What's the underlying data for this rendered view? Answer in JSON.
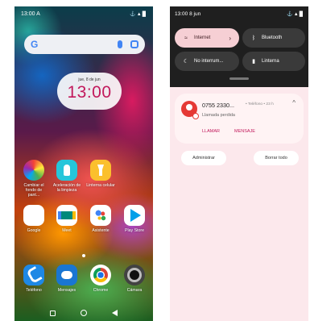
{
  "left_phone": {
    "status": {
      "time": "13:00",
      "extra": "A",
      "icons": "⚓▲█"
    },
    "search": {
      "logo": "G"
    },
    "clock": {
      "date": "jue, 8 de jun",
      "time": "13:00"
    },
    "apps_row1": [
      {
        "label": "Cambiar el fondo de pant..."
      },
      {
        "label": "Aceleración de la limpieza"
      },
      {
        "label": "Linterna celular"
      }
    ],
    "apps_row2": [
      {
        "label": "Google"
      },
      {
        "label": "Meet"
      },
      {
        "label": "Asistente"
      },
      {
        "label": "Play Store"
      }
    ],
    "dock": [
      {
        "label": "Teléfono"
      },
      {
        "label": "Mensajes"
      },
      {
        "label": "Chrome"
      },
      {
        "label": "Cámara"
      }
    ]
  },
  "right_phone": {
    "status": {
      "time": "13:00",
      "date": "8 jun",
      "icons": "⚓▲█"
    },
    "tiles": {
      "internet": "Internet",
      "bluetooth": "Bluetooth",
      "no_interrumpir": "No interrum...",
      "linterna": "Linterna"
    },
    "notification": {
      "number": "0755 2330...",
      "meta": "• Teléfono • 23 h",
      "text": "Llamada perdida",
      "action_call": "LLAMAR",
      "action_message": "MENSAJE"
    },
    "buttons": {
      "manage": "Administrar",
      "clear_all": "Borrar todo"
    }
  }
}
